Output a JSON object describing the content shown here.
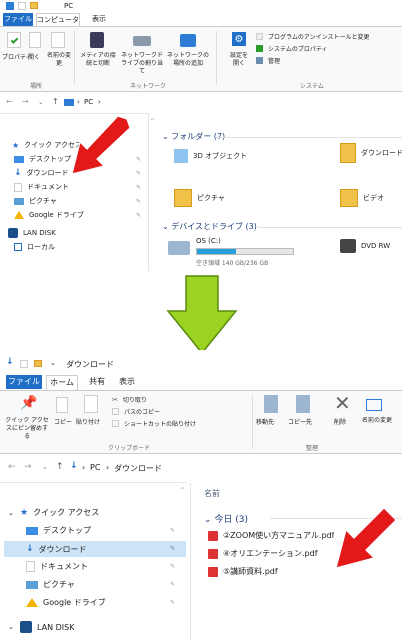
{
  "top": {
    "title": "PC",
    "tabs": [
      "ファイル",
      "コンピューター",
      "表示"
    ],
    "ribbon": {
      "items": [
        "プロパティ",
        "開く",
        "名前の変更",
        "メディアの接続と切断",
        "ネットワークドライブの割り当て",
        "ネットワークの場所の追加",
        "設定を開く",
        "プログラムのアンインストールと変更",
        "システムのプロパティ",
        "管理"
      ],
      "groups": [
        "場所",
        "ネットワーク",
        "システム"
      ]
    },
    "breadcrumb": [
      "PC"
    ],
    "sidebar": {
      "quick_access": "クイック アクセス",
      "items": [
        "デスクトップ",
        "ダウンロード",
        "ドキュメント",
        "ピクチャ",
        "Google ドライブ",
        "LAN DISK",
        "ローカル"
      ]
    },
    "folders_header": "フォルダー (7)",
    "folders": [
      "3D オブジェクト",
      "ダウンロード",
      "ピクチャ",
      "ビデオ"
    ],
    "devices_header": "デバイスとドライブ (3)",
    "drive": {
      "name": "OS (C:)",
      "free": "空き領域 140 GB/236 GB",
      "used_fraction": 0.41,
      "dvd": "DVD RW"
    }
  },
  "bottom": {
    "title": "ダウンロード",
    "tabs": [
      "ファイル",
      "ホーム",
      "共有",
      "表示"
    ],
    "ribbon": {
      "clipboard_items": [
        "クイック アクセスにピン留めする",
        "コピー",
        "貼り付け",
        "切り取り",
        "パスのコピー",
        "ショートカットの貼り付け"
      ],
      "organize_items": [
        "移動先",
        "コピー先",
        "削除",
        "名前の変更"
      ],
      "groups": [
        "クリップボード",
        "整理"
      ]
    },
    "breadcrumb": [
      "PC",
      "ダウンロード"
    ],
    "sidebar": {
      "quick_access": "クイック アクセス",
      "items": [
        "デスクトップ",
        "ダウンロード",
        "ドキュメント",
        "ピクチャ",
        "Google ドライブ",
        "LAN DISK"
      ]
    },
    "column_header": "名前",
    "group_header": "今日 (3)",
    "files": [
      "②ZOOM使い方マニュアル.pdf",
      "④オリエンテーション.pdf",
      "⑤講師資料.pdf"
    ]
  },
  "colors": {
    "accent": "#1f6fc7",
    "arrow_red": "#e31818",
    "arrow_green": "#9bd322",
    "selection": "#cce4f7"
  }
}
